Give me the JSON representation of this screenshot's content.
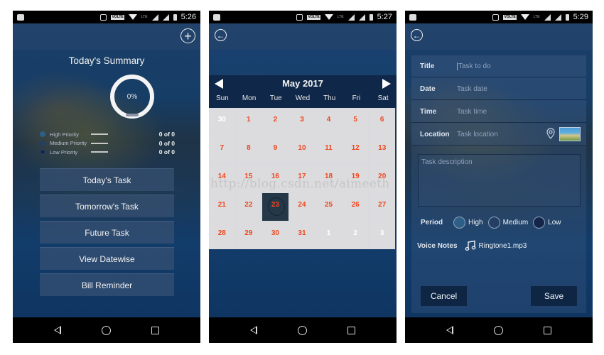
{
  "colors": {
    "accent_date": "#f0461e",
    "calendar_header": "#0f2748",
    "button_dark": "#0e2544",
    "high_priority": "#2e5f86",
    "medium_priority": "#243f63",
    "low_priority": "#15254a"
  },
  "watermark": "http://blog.csdn.net/aimeeth",
  "screens": [
    {
      "status": {
        "time": "5:26",
        "network": "VOLTE",
        "lte": "LTE"
      },
      "appbar": {
        "action_icon": "add-icon"
      },
      "summary": {
        "title": "Today's Summary",
        "progress_percent_label": "0%",
        "progress": 0,
        "priorities": [
          {
            "label": "High Priority",
            "count": "0 of 0"
          },
          {
            "label": "Medium Priority",
            "count": "0 of 0"
          },
          {
            "label": "Low Priority",
            "count": "0 of 0"
          }
        ]
      },
      "menu": [
        {
          "label": "Today's Task"
        },
        {
          "label": "Tomorrow's Task"
        },
        {
          "label": "Future Task"
        },
        {
          "label": "View Datewise"
        },
        {
          "label": "Bill Reminder"
        }
      ]
    },
    {
      "status": {
        "time": "5:27",
        "network": "VOLTE",
        "lte": "LTE"
      },
      "appbar": {
        "action_icon": "back-icon"
      },
      "calendar": {
        "title": "May 2017",
        "weekdays": [
          "Sun",
          "Mon",
          "Tue",
          "Wed",
          "Thu",
          "Fri",
          "Sat"
        ],
        "selected": "23",
        "days": [
          {
            "d": "30",
            "other": true
          },
          {
            "d": "1"
          },
          {
            "d": "2"
          },
          {
            "d": "3"
          },
          {
            "d": "4"
          },
          {
            "d": "5"
          },
          {
            "d": "6"
          },
          {
            "d": "7"
          },
          {
            "d": "8"
          },
          {
            "d": "9"
          },
          {
            "d": "10"
          },
          {
            "d": "11"
          },
          {
            "d": "12"
          },
          {
            "d": "13"
          },
          {
            "d": "14"
          },
          {
            "d": "15"
          },
          {
            "d": "16"
          },
          {
            "d": "17"
          },
          {
            "d": "18"
          },
          {
            "d": "19"
          },
          {
            "d": "20"
          },
          {
            "d": "21"
          },
          {
            "d": "22"
          },
          {
            "d": "23",
            "selected": true
          },
          {
            "d": "24"
          },
          {
            "d": "25"
          },
          {
            "d": "26"
          },
          {
            "d": "27"
          },
          {
            "d": "28"
          },
          {
            "d": "29"
          },
          {
            "d": "30"
          },
          {
            "d": "31"
          },
          {
            "d": "1",
            "other": true
          },
          {
            "d": "2",
            "other": true
          },
          {
            "d": "3",
            "other": true
          }
        ]
      }
    },
    {
      "status": {
        "time": "5:29",
        "network": "VOLTE",
        "lte": "LTE"
      },
      "appbar": {
        "action_icon": "back-icon"
      },
      "form": {
        "fields": [
          {
            "label": "Title",
            "placeholder": "Task to do",
            "value": ""
          },
          {
            "label": "Date",
            "placeholder": "Task date",
            "value": ""
          },
          {
            "label": "Time",
            "placeholder": "Task time",
            "value": ""
          },
          {
            "label": "Location",
            "placeholder": "Task location",
            "value": ""
          }
        ],
        "description_placeholder": "Task description",
        "period_label": "Period",
        "period_options": [
          "High",
          "Medium",
          "Low"
        ],
        "voice_notes_label": "Voice Notes",
        "voice_file": "Ringtone1.mp3",
        "cancel_label": "Cancel",
        "save_label": "Save"
      }
    }
  ]
}
